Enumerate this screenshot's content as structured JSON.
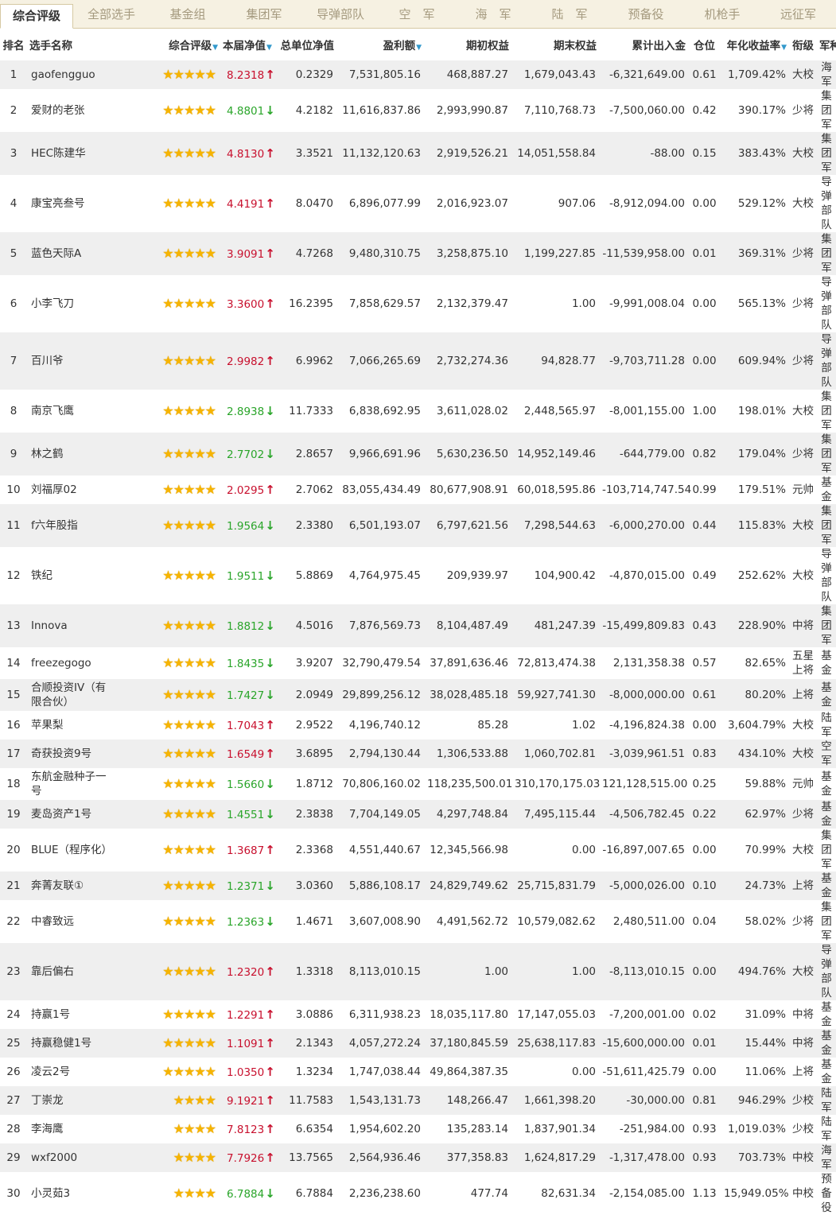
{
  "tabs": [
    {
      "label": "综合评级",
      "active": true
    },
    {
      "label": "全部选手"
    },
    {
      "label": "基金组"
    },
    {
      "label": "集团军"
    },
    {
      "label": "导弹部队"
    },
    {
      "label": "空　军"
    },
    {
      "label": "海　军"
    },
    {
      "label": "陆　军"
    },
    {
      "label": "预备役"
    },
    {
      "label": "机枪手"
    },
    {
      "label": "远征军"
    }
  ],
  "columns": {
    "rank": "排名",
    "name": "选手名称",
    "rating": "综合评级",
    "period_nav": "本届净值",
    "total_nav": "总单位净值",
    "profit": "盈利额",
    "start_equity": "期初权益",
    "end_equity": "期末权益",
    "net_flow": "累计出入金",
    "position": "仓位",
    "annual_return": "年化收益率",
    "rank_title": "衔级",
    "branch": "军种"
  },
  "colors": {
    "up": "#c8102e",
    "down": "#2aa52a",
    "star": "#f6b400",
    "sort": "#3399cc"
  },
  "icons": {
    "star": "star-icon",
    "up": "arrow-up-icon",
    "down": "arrow-down-icon",
    "sort": "sort-desc-icon"
  },
  "rows": [
    {
      "rank": "1",
      "name": "gaofengguo",
      "stars": 5,
      "nav": "8.2318",
      "dir": "up",
      "total_nav": "0.2329",
      "profit": "7,531,805.16",
      "start": "468,887.27",
      "end": "1,679,043.43",
      "flow": "-6,321,649.00",
      "position": "0.61",
      "annual": "1,709.42%",
      "title": "大校",
      "branch": "海军",
      "h": 31
    },
    {
      "rank": "2",
      "name": "爱财的老张",
      "stars": 5,
      "nav": "4.8801",
      "dir": "down",
      "total_nav": "4.2182",
      "profit": "11,616,837.86",
      "start": "2,993,990.87",
      "end": "7,110,768.73",
      "flow": "-7,500,060.00",
      "position": "0.42",
      "annual": "390.17%",
      "title": "少将",
      "branch": "集团军",
      "h": 31
    },
    {
      "rank": "3",
      "name": "HEC陈建华",
      "stars": 5,
      "nav": "4.8130",
      "dir": "up",
      "total_nav": "3.3521",
      "profit": "11,132,120.63",
      "start": "2,919,526.21",
      "end": "14,051,558.84",
      "flow": "-88.00",
      "position": "0.15",
      "annual": "383.43%",
      "title": "大校",
      "branch": "集团军",
      "h": 31
    },
    {
      "rank": "4",
      "name": "康宝亮叁号",
      "stars": 5,
      "nav": "4.4191",
      "dir": "up",
      "total_nav": "8.0470",
      "profit": "6,896,077.99",
      "start": "2,016,923.07",
      "end": "907.06",
      "flow": "-8,912,094.00",
      "position": "0.00",
      "annual": "529.12%",
      "title": "大校",
      "branch": "导弹部队",
      "h": 40
    },
    {
      "rank": "5",
      "name": "蓝色天际A",
      "stars": 5,
      "nav": "3.9091",
      "dir": "up",
      "total_nav": "4.7268",
      "profit": "9,480,310.75",
      "start": "3,258,875.10",
      "end": "1,199,227.85",
      "flow": "-11,539,958.00",
      "position": "0.01",
      "annual": "369.31%",
      "title": "少将",
      "branch": "集团军",
      "h": 31
    },
    {
      "rank": "6",
      "name": "小李飞刀",
      "stars": 5,
      "nav": "3.3600",
      "dir": "up",
      "total_nav": "16.2395",
      "profit": "7,858,629.57",
      "start": "2,132,379.47",
      "end": "1.00",
      "flow": "-9,991,008.04",
      "position": "0.00",
      "annual": "565.13%",
      "title": "少将",
      "branch": "导弹部队",
      "h": 40
    },
    {
      "rank": "7",
      "name": "百川爷",
      "stars": 5,
      "nav": "2.9982",
      "dir": "up",
      "total_nav": "6.9962",
      "profit": "7,066,265.69",
      "start": "2,732,274.36",
      "end": "94,828.77",
      "flow": "-9,703,711.28",
      "position": "0.00",
      "annual": "609.94%",
      "title": "少将",
      "branch": "导弹部队",
      "h": 40
    },
    {
      "rank": "8",
      "name": "南京飞鹰",
      "stars": 5,
      "nav": "2.8938",
      "dir": "down",
      "total_nav": "11.7333",
      "profit": "6,838,692.95",
      "start": "3,611,028.02",
      "end": "2,448,565.97",
      "flow": "-8,001,155.00",
      "position": "1.00",
      "annual": "198.01%",
      "title": "大校",
      "branch": "集团军",
      "h": 31
    },
    {
      "rank": "9",
      "name": "林之鹤",
      "stars": 5,
      "nav": "2.7702",
      "dir": "down",
      "total_nav": "2.8657",
      "profit": "9,966,691.96",
      "start": "5,630,236.50",
      "end": "14,952,149.46",
      "flow": "-644,779.00",
      "position": "0.82",
      "annual": "179.04%",
      "title": "少将",
      "branch": "集团军",
      "h": 31
    },
    {
      "rank": "10",
      "name": "刘福厚02",
      "stars": 5,
      "nav": "2.0295",
      "dir": "up",
      "total_nav": "2.7062",
      "profit": "83,055,434.49",
      "start": "80,677,908.91",
      "end": "60,018,595.86",
      "flow": "-103,714,747.54",
      "position": "0.99",
      "annual": "179.51%",
      "title": "元帅",
      "branch": "基金",
      "h": 31
    },
    {
      "rank": "11",
      "name": "f六年股指",
      "stars": 5,
      "nav": "1.9564",
      "dir": "down",
      "total_nav": "2.3380",
      "profit": "6,501,193.07",
      "start": "6,797,621.56",
      "end": "7,298,544.63",
      "flow": "-6,000,270.00",
      "position": "0.44",
      "annual": "115.83%",
      "title": "大校",
      "branch": "集团军",
      "h": 31
    },
    {
      "rank": "12",
      "name": "铁纪",
      "stars": 5,
      "nav": "1.9511",
      "dir": "down",
      "total_nav": "5.8869",
      "profit": "4,764,975.45",
      "start": "209,939.97",
      "end": "104,900.42",
      "flow": "-4,870,015.00",
      "position": "0.49",
      "annual": "252.62%",
      "title": "大校",
      "branch": "导弹部队",
      "h": 40
    },
    {
      "rank": "13",
      "name": "Innova",
      "stars": 5,
      "nav": "1.8812",
      "dir": "down",
      "total_nav": "4.5016",
      "profit": "7,876,569.73",
      "start": "8,104,487.49",
      "end": "481,247.39",
      "flow": "-15,499,809.83",
      "position": "0.43",
      "annual": "228.90%",
      "title": "中将",
      "branch": "集团军",
      "h": 31
    },
    {
      "rank": "14",
      "name": "freezegogo",
      "stars": 5,
      "nav": "1.8435",
      "dir": "down",
      "total_nav": "3.9207",
      "profit": "32,790,479.54",
      "start": "37,891,636.46",
      "end": "72,813,474.38",
      "flow": "2,131,358.38",
      "position": "0.57",
      "annual": "82.65%",
      "title": "五星上将",
      "branch": "基金",
      "h": 40
    },
    {
      "rank": "15",
      "name": "合顺投资IV（有限合伙）",
      "stars": 5,
      "nav": "1.7427",
      "dir": "down",
      "total_nav": "2.0949",
      "profit": "29,899,256.12",
      "start": "38,028,485.18",
      "end": "59,927,741.30",
      "flow": "-8,000,000.00",
      "position": "0.61",
      "annual": "80.20%",
      "title": "上将",
      "branch": "基金",
      "h": 40
    },
    {
      "rank": "16",
      "name": "苹果梨",
      "stars": 5,
      "nav": "1.7043",
      "dir": "up",
      "total_nav": "2.9522",
      "profit": "4,196,740.12",
      "start": "85.28",
      "end": "1.02",
      "flow": "-4,196,824.38",
      "position": "0.00",
      "annual": "3,604.79%",
      "title": "大校",
      "branch": "陆军",
      "h": 31
    },
    {
      "rank": "17",
      "name": "奇获投资9号",
      "stars": 5,
      "nav": "1.6549",
      "dir": "up",
      "total_nav": "3.6895",
      "profit": "2,794,130.44",
      "start": "1,306,533.88",
      "end": "1,060,702.81",
      "flow": "-3,039,961.51",
      "position": "0.83",
      "annual": "434.10%",
      "title": "大校",
      "branch": "空军",
      "h": 31
    },
    {
      "rank": "18",
      "name": "东航金融种子一号",
      "stars": 5,
      "nav": "1.5660",
      "dir": "down",
      "total_nav": "1.8712",
      "profit": "70,806,160.02",
      "start": "118,235,500.01",
      "end": "310,170,175.03",
      "flow": "121,128,515.00",
      "position": "0.25",
      "annual": "59.88%",
      "title": "元帅",
      "branch": "基金",
      "h": 40
    },
    {
      "rank": "19",
      "name": "麦岛资产1号",
      "stars": 5,
      "nav": "1.4551",
      "dir": "down",
      "total_nav": "2.3838",
      "profit": "7,704,149.05",
      "start": "4,297,748.84",
      "end": "7,495,115.44",
      "flow": "-4,506,782.45",
      "position": "0.22",
      "annual": "62.97%",
      "title": "少将",
      "branch": "基金",
      "h": 31
    },
    {
      "rank": "20",
      "name": "BLUE（程序化）",
      "stars": 5,
      "nav": "1.3687",
      "dir": "up",
      "total_nav": "2.3368",
      "profit": "4,551,440.67",
      "start": "12,345,566.98",
      "end": "0.00",
      "flow": "-16,897,007.65",
      "position": "0.00",
      "annual": "70.99%",
      "title": "大校",
      "branch": "集团军",
      "h": 31
    },
    {
      "rank": "21",
      "name": "奔菁友联①",
      "stars": 5,
      "nav": "1.2371",
      "dir": "down",
      "total_nav": "3.0360",
      "profit": "5,886,108.17",
      "start": "24,829,749.62",
      "end": "25,715,831.79",
      "flow": "-5,000,026.00",
      "position": "0.10",
      "annual": "24.73%",
      "title": "上将",
      "branch": "基金",
      "h": 31
    },
    {
      "rank": "22",
      "name": "中睿致远",
      "stars": 5,
      "nav": "1.2363",
      "dir": "down",
      "total_nav": "1.4671",
      "profit": "3,607,008.90",
      "start": "4,491,562.72",
      "end": "10,579,082.62",
      "flow": "2,480,511.00",
      "position": "0.04",
      "annual": "58.02%",
      "title": "少将",
      "branch": "集团军",
      "h": 31
    },
    {
      "rank": "23",
      "name": "靠后偏右",
      "stars": 5,
      "nav": "1.2320",
      "dir": "up",
      "total_nav": "1.3318",
      "profit": "8,113,010.15",
      "start": "1.00",
      "end": "1.00",
      "flow": "-8,113,010.15",
      "position": "0.00",
      "annual": "494.76%",
      "title": "大校",
      "branch": "导弹部队",
      "h": 40
    },
    {
      "rank": "24",
      "name": "持赢1号",
      "stars": 5,
      "nav": "1.2291",
      "dir": "up",
      "total_nav": "3.0886",
      "profit": "6,311,938.23",
      "start": "18,035,117.80",
      "end": "17,147,055.03",
      "flow": "-7,200,001.00",
      "position": "0.02",
      "annual": "31.09%",
      "title": "中将",
      "branch": "基金",
      "h": 31
    },
    {
      "rank": "25",
      "name": "持赢稳健1号",
      "stars": 5,
      "nav": "1.1091",
      "dir": "up",
      "total_nav": "2.1343",
      "profit": "4,057,272.24",
      "start": "37,180,845.59",
      "end": "25,638,117.83",
      "flow": "-15,600,000.00",
      "position": "0.01",
      "annual": "15.44%",
      "title": "中将",
      "branch": "基金",
      "h": 31
    },
    {
      "rank": "26",
      "name": "凌云2号",
      "stars": 5,
      "nav": "1.0350",
      "dir": "up",
      "total_nav": "1.3234",
      "profit": "1,747,038.44",
      "start": "49,864,387.35",
      "end": "0.00",
      "flow": "-51,611,425.79",
      "position": "0.00",
      "annual": "11.06%",
      "title": "上将",
      "branch": "基金",
      "h": 31
    },
    {
      "rank": "27",
      "name": "丁崇龙",
      "stars": 4,
      "nav": "9.1921",
      "dir": "up",
      "total_nav": "11.7583",
      "profit": "1,543,131.73",
      "start": "148,266.47",
      "end": "1,661,398.20",
      "flow": "-30,000.00",
      "position": "0.81",
      "annual": "946.29%",
      "title": "少校",
      "branch": "陆军",
      "h": 31
    },
    {
      "rank": "28",
      "name": "李海鹰",
      "stars": 4,
      "nav": "7.8123",
      "dir": "up",
      "total_nav": "6.6354",
      "profit": "1,954,602.20",
      "start": "135,283.14",
      "end": "1,837,901.34",
      "flow": "-251,984.00",
      "position": "0.93",
      "annual": "1,019.03%",
      "title": "少校",
      "branch": "陆军",
      "h": 31
    },
    {
      "rank": "29",
      "name": "wxf2000",
      "stars": 4,
      "nav": "7.7926",
      "dir": "up",
      "total_nav": "13.7565",
      "profit": "2,564,936.46",
      "start": "377,358.83",
      "end": "1,624,817.29",
      "flow": "-1,317,478.00",
      "position": "0.93",
      "annual": "703.73%",
      "title": "中校",
      "branch": "海军",
      "h": 31
    },
    {
      "rank": "30",
      "name": "小灵茹3",
      "stars": 4,
      "nav": "6.7884",
      "dir": "down",
      "total_nav": "6.7884",
      "profit": "2,236,238.60",
      "start": "477.74",
      "end": "82,631.34",
      "flow": "-2,154,085.00",
      "position": "1.13",
      "annual": "15,949.05%",
      "title": "中校",
      "branch": "预备役",
      "h": 31
    }
  ]
}
